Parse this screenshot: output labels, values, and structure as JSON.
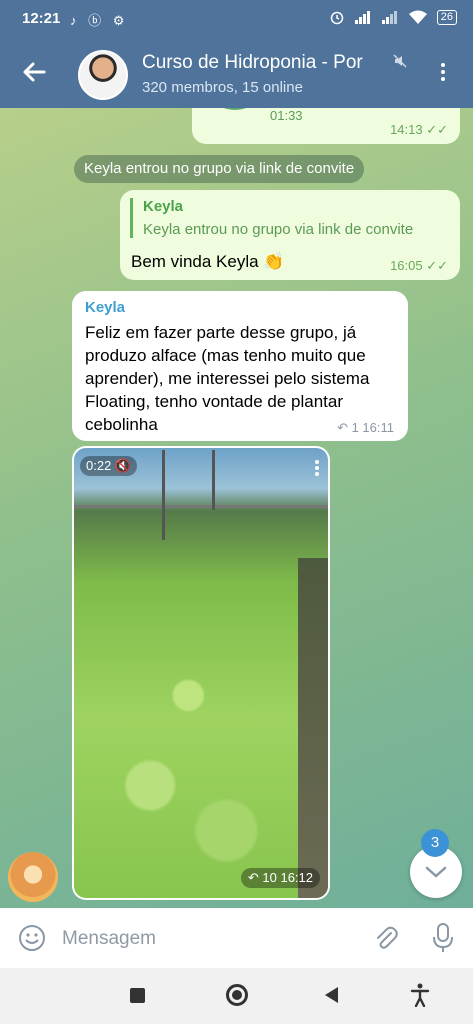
{
  "status_bar": {
    "time": "12:21",
    "app_icons": "♪ ⓑ ⚙",
    "battery": "26"
  },
  "header": {
    "title": "Curso de Hidroponia - Por",
    "subtitle": "320 membros, 15 online"
  },
  "messages": {
    "prev_voice": {
      "duration": "01:33",
      "time": "14:13 ✓✓"
    },
    "service": {
      "text": "Keyla entrou no grupo via link de convite"
    },
    "reply_msg": {
      "reply_name": "Keyla",
      "reply_text": "Keyla entrou no grupo via link de convite",
      "text": "Bem vinda Keyla 👏",
      "time": "16:05 ✓✓"
    },
    "incoming": {
      "sender": "Keyla",
      "text": "Feliz em fazer parte desse grupo, já produzo alface (mas tenho muito que aprender),  me interessei pelo sistema Floating, tenho vontade de plantar cebolinha",
      "meta": "↶ 1  16:11"
    },
    "video": {
      "duration": "0:22 🔇",
      "meta": "↶ 10  16:12"
    }
  },
  "scroll_badge": "3",
  "composer": {
    "placeholder": "Mensagem"
  },
  "colors": {
    "header": "#4f739a",
    "out_bubble": "#effdde",
    "accent": "#3c92d6"
  }
}
